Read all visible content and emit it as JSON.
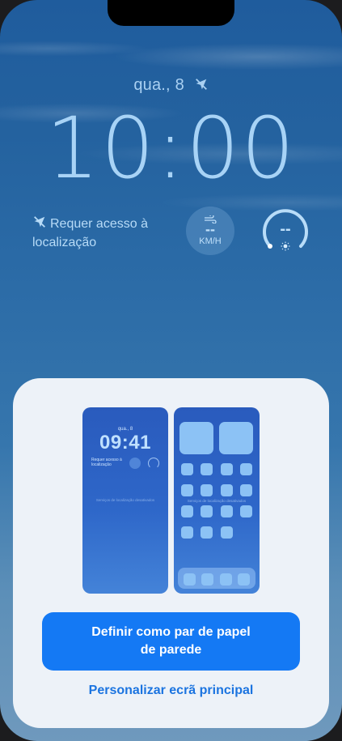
{
  "lock_screen": {
    "date": "qua., 8",
    "time": "10:00",
    "location_widget": {
      "text": "Requer acesso à localização",
      "icon": "location-off-icon"
    },
    "wind_widget": {
      "value": "--",
      "unit": "KM/H",
      "icon": "wind-icon"
    },
    "uv_widget": {
      "value": "--",
      "icon": "sun-icon"
    }
  },
  "sheet": {
    "lock_preview": {
      "date": "qua., 8",
      "time": "09:41",
      "location_text": "Requer acesso à localização",
      "services_text": "Serviços de localização desativados"
    },
    "home_preview": {
      "services_text": "Serviços de localização desativados"
    },
    "primary_button": "Definir como par de papel de parede",
    "secondary_button": "Personalizar ecrã principal"
  },
  "colors": {
    "wallpaper_top": "#1f5c9d",
    "accent": "#1479f4",
    "sheet_bg": "#edf2f8"
  }
}
